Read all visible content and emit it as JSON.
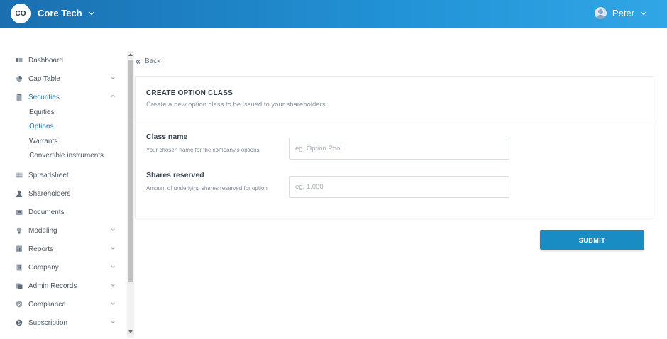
{
  "header": {
    "logo_initials": "CO",
    "company_name": "Core Tech",
    "user_name": "Peter"
  },
  "sidebar": {
    "items": [
      {
        "label": "Dashboard",
        "icon": "dashboard-icon",
        "expandable": false
      },
      {
        "label": "Cap Table",
        "icon": "pie-chart-icon",
        "expandable": true
      },
      {
        "label": "Securities",
        "icon": "clipboard-icon",
        "expandable": true,
        "expanded": true
      },
      {
        "label": "Spreadsheet",
        "icon": "spreadsheet-icon",
        "expandable": false
      },
      {
        "label": "Shareholders",
        "icon": "person-icon",
        "expandable": false
      },
      {
        "label": "Documents",
        "icon": "folder-icon",
        "expandable": false
      },
      {
        "label": "Modeling",
        "icon": "lightbulb-icon",
        "expandable": true
      },
      {
        "label": "Reports",
        "icon": "report-icon",
        "expandable": true
      },
      {
        "label": "Company",
        "icon": "building-icon",
        "expandable": true
      },
      {
        "label": "Admin Records",
        "icon": "records-icon",
        "expandable": true
      },
      {
        "label": "Compliance",
        "icon": "shield-check-icon",
        "expandable": true
      },
      {
        "label": "Subscription",
        "icon": "dollar-icon",
        "expandable": true
      }
    ],
    "securities_sub": [
      "Equities",
      "Options",
      "Warrants",
      "Convertible instruments"
    ],
    "active_sub": "Options"
  },
  "back_label": "Back",
  "form": {
    "title": "CREATE OPTION CLASS",
    "subtitle": "Create a new option class to be issued to your shareholders",
    "fields": [
      {
        "label": "Class name",
        "help": "Your chosen name for the company's options",
        "placeholder": "eg. Option Pool",
        "value": ""
      },
      {
        "label": "Shares reserved",
        "help": "Amount of underlying shares reserved for option",
        "placeholder": "eg. 1,000",
        "value": ""
      }
    ],
    "submit_label": "SUBMIT"
  },
  "colors": {
    "header_start": "#1a6fb0",
    "header_end": "#31a6e6",
    "accent": "#1e78b8",
    "submit": "#1a8cc4"
  }
}
